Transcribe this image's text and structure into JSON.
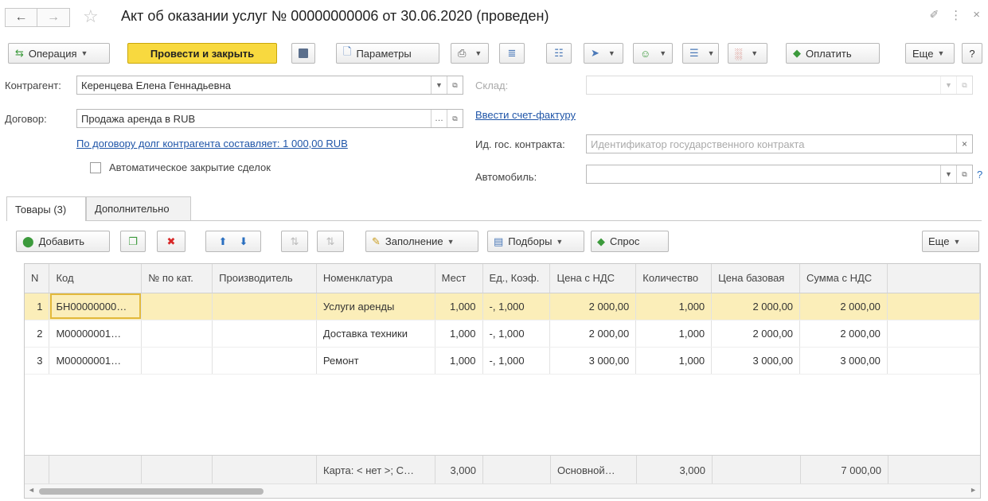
{
  "window": {
    "title": "Акт об оказании услуг № 00000000006 от 30.06.2020 (проведен)",
    "back_icon": "←",
    "forward_icon": "→",
    "star_icon": "☆",
    "link_icon": "🔗",
    "more_icon": "⋮",
    "close_icon": "×"
  },
  "toolbar": {
    "operation": "Операция",
    "post_and_close": "Провести и закрыть",
    "parameters": "Параметры",
    "pay": "Оплатить",
    "more": "Еще",
    "help": "?"
  },
  "form": {
    "counterparty_label": "Контрагент:",
    "counterparty_value": "Керенцева Елена Геннадьевна",
    "contract_label": "Договор:",
    "contract_value": "Продажа аренда в RUB",
    "debt_link": "По договору долг контрагента составляет: 1 000,00 RUB",
    "auto_close_label": "Автоматическое закрытие сделок",
    "warehouse_label": "Склад:",
    "invoice_link": "Ввести счет-фактуру",
    "gov_contract_label": "Ид. гос. контракта:",
    "gov_contract_placeholder": "Идентификатор государственного контракта",
    "car_label": "Автомобиль:",
    "help_mark": "?"
  },
  "tabs": [
    {
      "label": "Товары (3)"
    },
    {
      "label": "Дополнительно"
    }
  ],
  "table_toolbar": {
    "add": "Добавить",
    "fill": "Заполнение",
    "selections": "Подборы",
    "demand": "Спрос",
    "more": "Еще"
  },
  "table": {
    "columns": [
      "N",
      "Код",
      "№ по кат.",
      "Производитель",
      "Номенклатура",
      "Мест",
      "Ед., Коэф.",
      "Цена с НДС",
      "Количество",
      "Цена базовая",
      "Сумма с НДС"
    ],
    "rows": [
      {
        "n": "1",
        "code": "БН00000000…",
        "cat": "",
        "maker": "",
        "item": "Услуги аренды",
        "places": "1,000",
        "unit": "-, 1,000",
        "price": "2 000,00",
        "qty": "1,000",
        "base": "2 000,00",
        "sum": "2 000,00"
      },
      {
        "n": "2",
        "code": "М00000001…",
        "cat": "",
        "maker": "",
        "item": "Доставка техники",
        "places": "1,000",
        "unit": "-, 1,000",
        "price": "2 000,00",
        "qty": "1,000",
        "base": "2 000,00",
        "sum": "2 000,00"
      },
      {
        "n": "3",
        "code": "М00000001…",
        "cat": "",
        "maker": "",
        "item": "Ремонт",
        "places": "1,000",
        "unit": "-, 1,000",
        "price": "3 000,00",
        "qty": "1,000",
        "base": "3 000,00",
        "sum": "3 000,00"
      }
    ],
    "footer": {
      "item": "Карта: < нет >; С…",
      "places": "3,000",
      "price": "Основной…",
      "qty": "3,000",
      "sum": "7 000,00"
    }
  }
}
